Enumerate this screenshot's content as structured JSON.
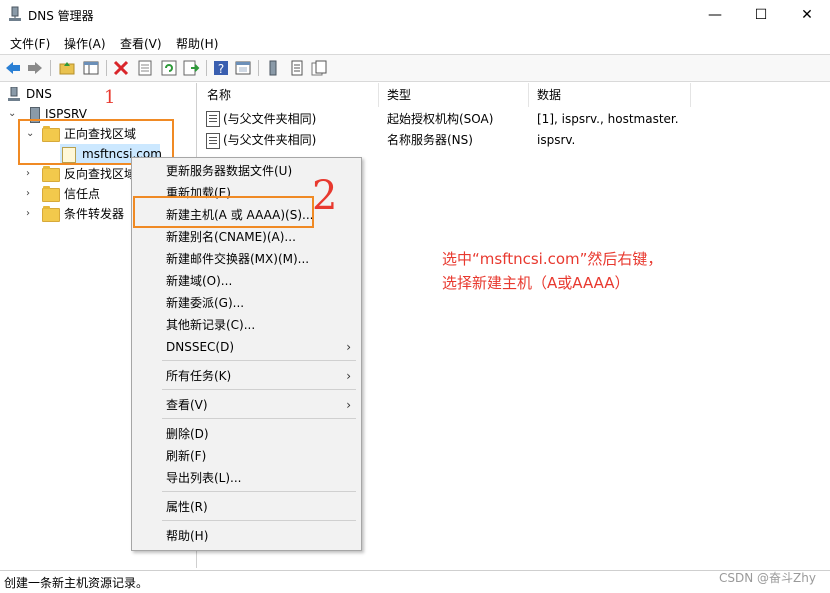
{
  "window": {
    "title": "DNS 管理器",
    "buttons": {
      "minimize": "—",
      "maximize": "☐",
      "close": "✕"
    }
  },
  "menubar": [
    "文件(F)",
    "操作(A)",
    "查看(V)",
    "帮助(H)"
  ],
  "toolbar": [
    "back-icon",
    "forward-icon",
    "up-folder-icon",
    "show-hide-tree-icon",
    "delete-icon",
    "properties-icon",
    "refresh-icon",
    "export-icon",
    "help-icon",
    "console-icon",
    "server-icon",
    "list-icon",
    "records-icon"
  ],
  "tree": {
    "root": "DNS",
    "server": "ISPSRV",
    "forward_zone": "正向查找区域",
    "zone": "msftncsi.com",
    "reverse_zone": "反向查找区域",
    "trust_points": "信任点",
    "conditional_forwarders": "条件转发器"
  },
  "list": {
    "columns": [
      "名称",
      "类型",
      "数据"
    ],
    "rows": [
      {
        "name": "(与父文件夹相同)",
        "type": "起始授权机构(SOA)",
        "data": "[1], ispsrv., hostmaster."
      },
      {
        "name": "(与父文件夹相同)",
        "type": "名称服务器(NS)",
        "data": "ispsrv."
      }
    ]
  },
  "context_menu": {
    "items": [
      {
        "label": "更新服务器数据文件(U)"
      },
      {
        "label": "重新加载(E)"
      },
      {
        "label": "新建主机(A 或 AAAA)(S)..."
      },
      {
        "label": "新建别名(CNAME)(A)..."
      },
      {
        "label": "新建邮件交换器(MX)(M)..."
      },
      {
        "label": "新建域(O)..."
      },
      {
        "label": "新建委派(G)..."
      },
      {
        "label": "其他新记录(C)..."
      },
      {
        "label": "DNSSEC(D)",
        "submenu": true
      },
      {
        "label": "所有任务(K)",
        "submenu": true
      },
      {
        "label": "查看(V)",
        "submenu": true
      },
      {
        "label": "删除(D)"
      },
      {
        "label": "刷新(F)"
      },
      {
        "label": "导出列表(L)..."
      },
      {
        "label": "属性(R)"
      },
      {
        "label": "帮助(H)"
      }
    ],
    "submenu_arrow": "›"
  },
  "annotations": {
    "step1": "1",
    "step2": "2",
    "note_line1": "选中“msftncsi.com”然后右键，",
    "note_line2": "选择新建主机（A或AAAA）"
  },
  "statusbar": "创建一条新主机资源记录。",
  "watermark": "CSDN @奋斗Zhy",
  "colors": {
    "highlight_box": "#f08a24",
    "annotation_text": "#e8392f"
  }
}
